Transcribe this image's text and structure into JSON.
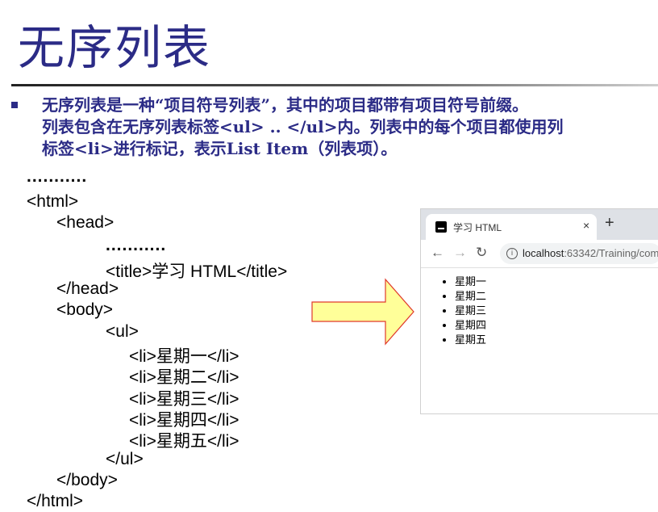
{
  "slide": {
    "title": "无序列表",
    "description_lines": [
      "无序列表是一种“项目符号列表”，其中的项目都带有项目符号前缀。",
      "列表包含在无序列表标签<ul> .. </ul>内。列表中的每个项目都使用列",
      "标签<li>进行标记，表示List Item（列表项）。"
    ]
  },
  "code": {
    "lines": [
      "...........",
      "<html>",
      "<head>",
      "...........",
      "<title>学习 HTML</title>",
      "</head>",
      "<body>",
      "<ul>",
      "<li>星期一</li>",
      "<li>星期二</li>",
      "<li>星期三</li>",
      "<li>星期四</li>",
      "<li>星期五</li>",
      "</ul>",
      "</body>",
      "</html>"
    ]
  },
  "browser": {
    "tab_title": "学习 HTML",
    "close_glyph": "×",
    "new_tab_glyph": "+",
    "back_glyph": "←",
    "forward_glyph": "→",
    "reload_glyph": "↻",
    "url_host": "localhost",
    "url_rest": ":63342/Training/com",
    "list_items": [
      "星期一",
      "星期二",
      "星期三",
      "星期四",
      "星期五"
    ]
  },
  "icons": {
    "favicon": "intellij-icon",
    "arrow": "right-arrow-icon"
  },
  "colors": {
    "title": "#2b2b86",
    "arrow_fill": "#ffff99",
    "arrow_stroke": "#e0392b"
  }
}
